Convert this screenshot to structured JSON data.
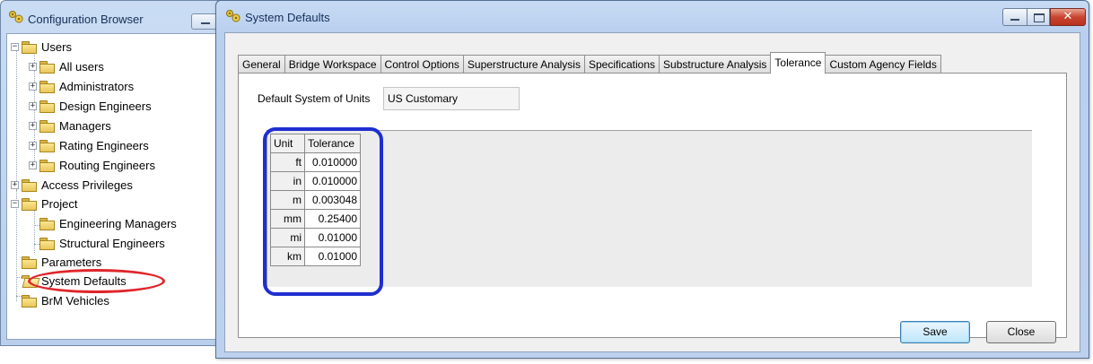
{
  "config_browser": {
    "title": "Configuration Browser",
    "tree": [
      {
        "label": "Users",
        "expander": "−"
      },
      {
        "label": "All users",
        "expander": "+"
      },
      {
        "label": "Administrators",
        "expander": "+"
      },
      {
        "label": "Design Engineers",
        "expander": "+"
      },
      {
        "label": "Managers",
        "expander": "+"
      },
      {
        "label": "Rating Engineers",
        "expander": "+"
      },
      {
        "label": "Routing Engineers",
        "expander": "+"
      },
      {
        "label": "Access Privileges",
        "expander": "+"
      },
      {
        "label": "Project",
        "expander": "−"
      },
      {
        "label": "Engineering Managers",
        "expander": ""
      },
      {
        "label": "Structural Engineers",
        "expander": ""
      },
      {
        "label": "Parameters",
        "expander": ""
      },
      {
        "label": "System Defaults",
        "expander": ""
      },
      {
        "label": "BrM Vehicles",
        "expander": ""
      }
    ],
    "selected_item": "System Defaults"
  },
  "system_defaults": {
    "title": "System Defaults",
    "close_glyph": "✕",
    "tabs": [
      {
        "label": "General",
        "active": false
      },
      {
        "label": "Bridge Workspace",
        "active": false
      },
      {
        "label": "Control Options",
        "active": false
      },
      {
        "label": "Superstructure Analysis",
        "active": false
      },
      {
        "label": "Specifications",
        "active": false
      },
      {
        "label": "Substructure Analysis",
        "active": false
      },
      {
        "label": "Tolerance",
        "active": true
      },
      {
        "label": "Custom Agency Fields",
        "active": false
      }
    ],
    "units_label": "Default System of Units",
    "units_value": "US Customary",
    "table": {
      "headers": [
        "Unit",
        "Tolerance"
      ],
      "rows": [
        {
          "unit": "ft",
          "tolerance": "0.010000"
        },
        {
          "unit": "in",
          "tolerance": "0.010000"
        },
        {
          "unit": "m",
          "tolerance": "0.003048"
        },
        {
          "unit": "mm",
          "tolerance": "0.25400"
        },
        {
          "unit": "mi",
          "tolerance": "0.01000"
        },
        {
          "unit": "km",
          "tolerance": "0.01000"
        }
      ]
    },
    "buttons": {
      "save": "Save",
      "close": "Close"
    }
  },
  "colors": {
    "highlight_red": "#e0252b",
    "highlight_blue": "#1f2ed0",
    "window_frame": "#b8cfee"
  }
}
